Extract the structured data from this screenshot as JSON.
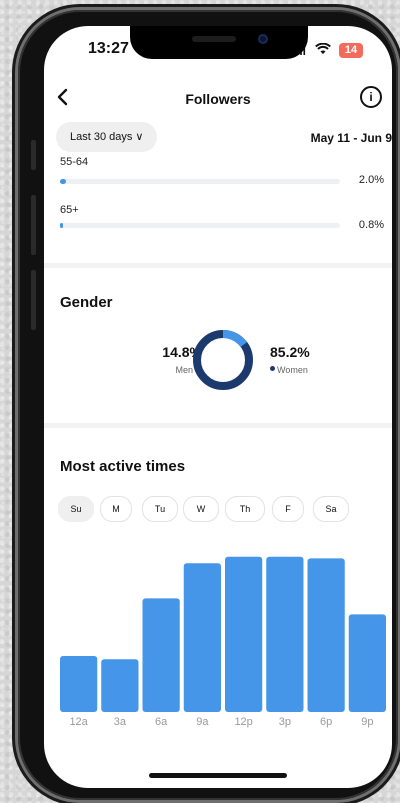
{
  "status": {
    "time": "13:27",
    "time_extra": "",
    "signal": "ııl",
    "battery": "14"
  },
  "nav": {
    "back": "<",
    "title": "Followers",
    "info": "i"
  },
  "filter": {
    "label": "Last 30 days ∨",
    "date_range": "May 11 - Jun 9"
  },
  "age": {
    "rows": [
      {
        "label": "55-64",
        "percent_text": "2.0%",
        "value": 2.0
      },
      {
        "label": "65+",
        "percent_text": "0.8%",
        "value": 0.8
      }
    ]
  },
  "gender": {
    "title": "Gender",
    "men": {
      "value": "14.8%",
      "label": "Men",
      "fraction": 0.148
    },
    "women": {
      "value": "85.2%",
      "label": "Women",
      "fraction": 0.852
    }
  },
  "active": {
    "title": "Most active times",
    "days": [
      "Su",
      "M",
      "Tu",
      "W",
      "Th",
      "F",
      "Sa"
    ],
    "selected_day": "Su"
  },
  "chart_data": {
    "type": "bar",
    "categories": [
      "12a",
      "3a",
      "6a",
      "9a",
      "12p",
      "3p",
      "6p",
      "9p"
    ],
    "values": [
      35,
      33,
      71,
      93,
      97,
      97,
      96,
      61
    ],
    "ylim": [
      0,
      100
    ],
    "title": "",
    "xlabel": "",
    "ylabel": "",
    "grid": false
  },
  "colors": {
    "accent": "#4595e8",
    "dark": "#1d3a6e",
    "track": "#eef0f3"
  }
}
